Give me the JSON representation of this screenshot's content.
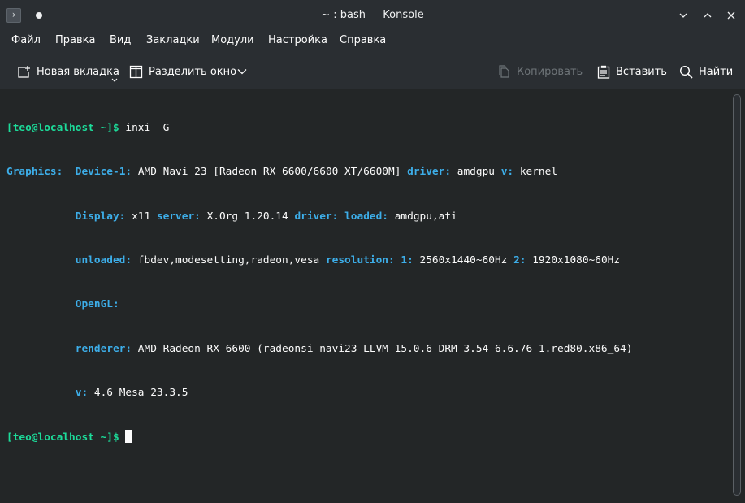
{
  "titlebar": {
    "title": "~ : bash — Konsole",
    "app_icon_glyph": "›",
    "minimize_glyph": "⌄",
    "maximize_glyph": "⌃",
    "close_glyph": "✕"
  },
  "menu": [
    "Файл",
    "Правка",
    "Вид",
    "Закладки",
    "Модули",
    "Настройка",
    "Справка"
  ],
  "toolbar": {
    "new_tab": "Новая вкладка",
    "split": "Разделить окно",
    "copy": "Копировать",
    "paste": "Вставить",
    "find": "Найти"
  },
  "terminal": {
    "prompt_user": "[teo@localhost ~]$",
    "command": " inxi -G",
    "graphics_label": "Graphics:",
    "l1": {
      "device_key": "Device-1:",
      "device_val": " AMD Navi 23 [Radeon RX 6600/6600 XT/6600M] ",
      "driver_key": "driver:",
      "driver_val": " amdgpu ",
      "v_key": "v:",
      "v_val": " kernel"
    },
    "l2": {
      "display_key": "Display:",
      "display_val": " x11 ",
      "server_key": "server:",
      "server_val": " X.Org 1.20.14 ",
      "driver_key": "driver:",
      "loaded_key": " loaded:",
      "loaded_val": " amdgpu,ati"
    },
    "l3": {
      "unloaded_key": "unloaded:",
      "unloaded_val": " fbdev,modesetting,radeon,vesa ",
      "res_key": "resolution:",
      "r1_key": " 1:",
      "r1_val": " 2560x1440~60Hz ",
      "r2_key": "2:",
      "r2_val": " 1920x1080~60Hz"
    },
    "l4": {
      "opengl_key": "OpenGL:"
    },
    "l5": {
      "renderer_key": "renderer:",
      "renderer_val": " AMD Radeon RX 6600 (radeonsi navi23 LLVM 15.0.6 DRM 3.54 6.6.76-1.red80.x86_64)"
    },
    "l6": {
      "v_key": "v:",
      "v_val": " 4.6 Mesa 23.3.5"
    }
  },
  "colors": {
    "window_bg": "#2a2e32",
    "terminal_bg": "#232627",
    "prompt_green": "#1cdc9a",
    "key_blue": "#3daee9",
    "text": "#fcfcfc"
  }
}
